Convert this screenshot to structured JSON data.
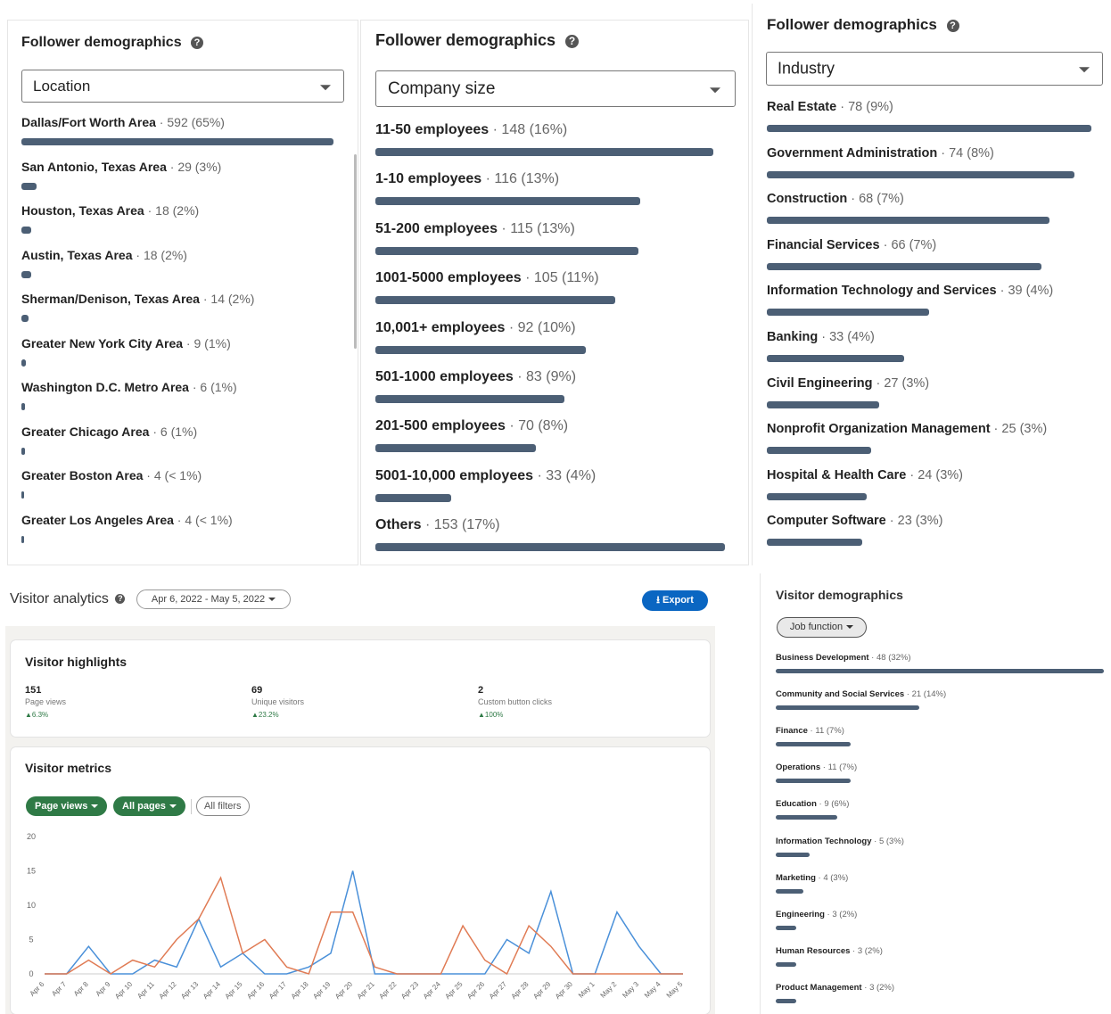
{
  "location_panel": {
    "title": "Follower demographics",
    "select_value": "Location",
    "items": [
      {
        "name": "Dallas/Fort Worth Area",
        "stat": "592 (65%)",
        "fraction": 1.0
      },
      {
        "name": "San Antonio, Texas Area",
        "stat": "29 (3%)",
        "fraction": 0.049
      },
      {
        "name": "Houston, Texas Area",
        "stat": "18 (2%)",
        "fraction": 0.03
      },
      {
        "name": "Austin, Texas Area",
        "stat": "18 (2%)",
        "fraction": 0.03
      },
      {
        "name": "Sherman/Denison, Texas Area",
        "stat": "14 (2%)",
        "fraction": 0.024
      },
      {
        "name": "Greater New York City Area",
        "stat": "9 (1%)",
        "fraction": 0.015
      },
      {
        "name": "Washington D.C. Metro Area",
        "stat": "6 (1%)",
        "fraction": 0.01
      },
      {
        "name": "Greater Chicago Area",
        "stat": "6 (1%)",
        "fraction": 0.01
      },
      {
        "name": "Greater Boston Area",
        "stat": "4 (< 1%)",
        "fraction": 0.007
      },
      {
        "name": "Greater Los Angeles Area",
        "stat": "4 (< 1%)",
        "fraction": 0.007
      }
    ]
  },
  "company_panel": {
    "title": "Follower demographics",
    "select_value": "Company size",
    "items": [
      {
        "name": "11-50 employees",
        "stat": "148 (16%)",
        "fraction": 0.967
      },
      {
        "name": "1-10 employees",
        "stat": "116 (13%)",
        "fraction": 0.758
      },
      {
        "name": "51-200 employees",
        "stat": "115 (13%)",
        "fraction": 0.752
      },
      {
        "name": "1001-5000 employees",
        "stat": "105 (11%)",
        "fraction": 0.686
      },
      {
        "name": "10,001+ employees",
        "stat": "92 (10%)",
        "fraction": 0.601
      },
      {
        "name": "501-1000 employees",
        "stat": "83 (9%)",
        "fraction": 0.542
      },
      {
        "name": "201-500 employees",
        "stat": "70 (8%)",
        "fraction": 0.458
      },
      {
        "name": "5001-10,000 employees",
        "stat": "33 (4%)",
        "fraction": 0.216
      },
      {
        "name": "Others",
        "stat": "153 (17%)",
        "fraction": 1.0
      }
    ]
  },
  "industry_panel": {
    "title": "Follower demographics",
    "select_value": "Industry",
    "items": [
      {
        "name": "Real Estate",
        "stat": "78 (9%)",
        "fraction": 1.0
      },
      {
        "name": "Government Administration",
        "stat": "74 (8%)",
        "fraction": 0.949
      },
      {
        "name": "Construction",
        "stat": "68 (7%)",
        "fraction": 0.872
      },
      {
        "name": "Financial Services",
        "stat": "66 (7%)",
        "fraction": 0.846
      },
      {
        "name": "Information Technology and Services",
        "stat": "39 (4%)",
        "fraction": 0.5
      },
      {
        "name": "Banking",
        "stat": "33 (4%)",
        "fraction": 0.423
      },
      {
        "name": "Civil Engineering",
        "stat": "27 (3%)",
        "fraction": 0.346
      },
      {
        "name": "Nonprofit Organization Management",
        "stat": "25 (3%)",
        "fraction": 0.321
      },
      {
        "name": "Hospital & Health Care",
        "stat": "24 (3%)",
        "fraction": 0.308
      },
      {
        "name": "Computer Software",
        "stat": "23 (3%)",
        "fraction": 0.295
      }
    ]
  },
  "analytics": {
    "title": "Visitor analytics",
    "date_range": "Apr 6, 2022 - May 5, 2022",
    "export_label": "Export",
    "highlights_title": "Visitor highlights",
    "highlights": [
      {
        "value": "151",
        "label": "Page views",
        "delta": "6.3%"
      },
      {
        "value": "69",
        "label": "Unique visitors",
        "delta": "23.2%"
      },
      {
        "value": "2",
        "label": "Custom button clicks",
        "delta": "100%"
      }
    ],
    "metrics_title": "Visitor metrics",
    "filter_page_views": "Page views",
    "filter_all_pages": "All pages",
    "filter_all_filters": "All filters"
  },
  "chart_data": {
    "type": "line",
    "x": [
      "Apr 6",
      "Apr 7",
      "Apr 8",
      "Apr 9",
      "Apr 10",
      "Apr 11",
      "Apr 12",
      "Apr 13",
      "Apr 14",
      "Apr 15",
      "Apr 16",
      "Apr 17",
      "Apr 18",
      "Apr 19",
      "Apr 20",
      "Apr 21",
      "Apr 22",
      "Apr 23",
      "Apr 24",
      "Apr 25",
      "Apr 26",
      "Apr 27",
      "Apr 28",
      "Apr 29",
      "Apr 30",
      "May 1",
      "May 2",
      "May 3",
      "May 4",
      "May 5"
    ],
    "yticks": [
      0,
      5,
      10,
      15,
      20
    ],
    "ylim": [
      0,
      20
    ],
    "grid": "horizontal baseline only",
    "legend": "none",
    "series": [
      {
        "color": "#4a90d9",
        "values": [
          0,
          0,
          4,
          0,
          0,
          2,
          1,
          8,
          1,
          3,
          0,
          0,
          1,
          3,
          15,
          0,
          0,
          0,
          0,
          0,
          0,
          5,
          3,
          12,
          0,
          0,
          9,
          4,
          0,
          0
        ]
      },
      {
        "color": "#e07b54",
        "values": [
          0,
          0,
          2,
          0,
          2,
          1,
          5,
          8,
          14,
          3,
          5,
          1,
          0,
          9,
          9,
          1,
          0,
          0,
          0,
          7,
          2,
          0,
          7,
          4,
          0,
          0,
          0,
          0,
          0,
          0
        ]
      }
    ]
  },
  "visitor_demographics": {
    "title": "Visitor demographics",
    "select_value": "Job function",
    "items": [
      {
        "name": "Business Development",
        "stat": "48 (32%)",
        "fraction": 1.0
      },
      {
        "name": "Community and Social Services",
        "stat": "21 (14%)",
        "fraction": 0.438
      },
      {
        "name": "Finance",
        "stat": "11 (7%)",
        "fraction": 0.229
      },
      {
        "name": "Operations",
        "stat": "11 (7%)",
        "fraction": 0.229
      },
      {
        "name": "Education",
        "stat": "9 (6%)",
        "fraction": 0.188
      },
      {
        "name": "Information Technology",
        "stat": "5 (3%)",
        "fraction": 0.104
      },
      {
        "name": "Marketing",
        "stat": "4 (3%)",
        "fraction": 0.083
      },
      {
        "name": "Engineering",
        "stat": "3 (2%)",
        "fraction": 0.063
      },
      {
        "name": "Human Resources",
        "stat": "3 (2%)",
        "fraction": 0.063
      },
      {
        "name": "Product Management",
        "stat": "3 (2%)",
        "fraction": 0.063
      }
    ]
  },
  "colors": {
    "bar": "#4c5f75",
    "green": "#2f7a46",
    "blue_button": "#0a66c2"
  }
}
